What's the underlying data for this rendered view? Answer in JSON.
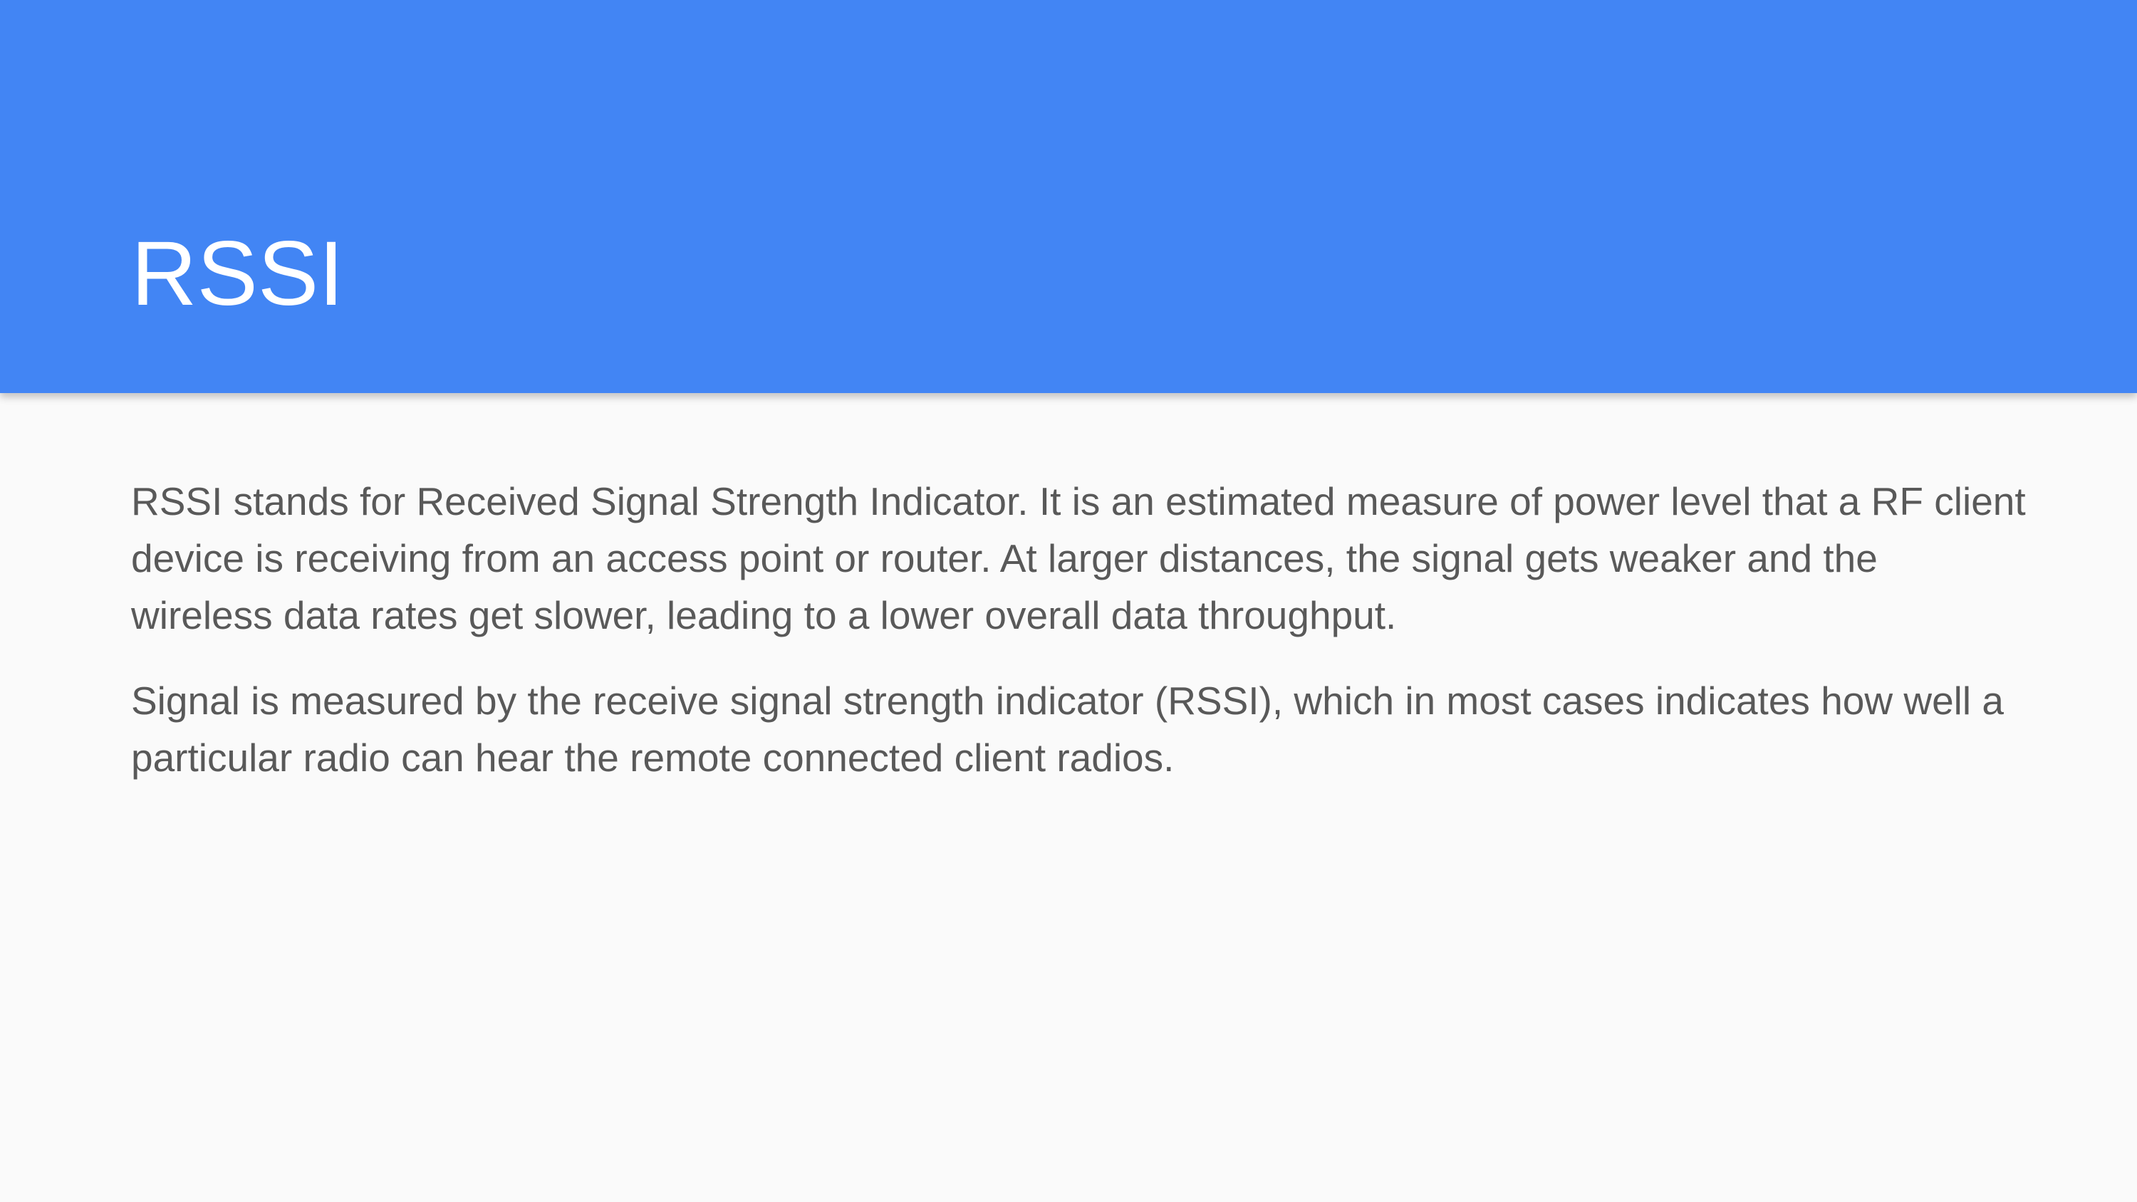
{
  "slide": {
    "title": "RSSI",
    "paragraphs": [
      "RSSI stands for Received Signal Strength Indicator. It is an estimated measure of power level that a RF client device is receiving from an access point or router. At larger distances, the signal gets weaker and the wireless data rates get slower, leading to a lower overall data throughput.",
      "Signal is measured by the receive signal strength indicator (RSSI), which in most cases indicates how well a particular radio can hear the remote connected client radios."
    ]
  },
  "colors": {
    "header_background": "#4285f4",
    "page_background": "#fafafa",
    "title_text": "#ffffff",
    "body_text": "#595959"
  }
}
